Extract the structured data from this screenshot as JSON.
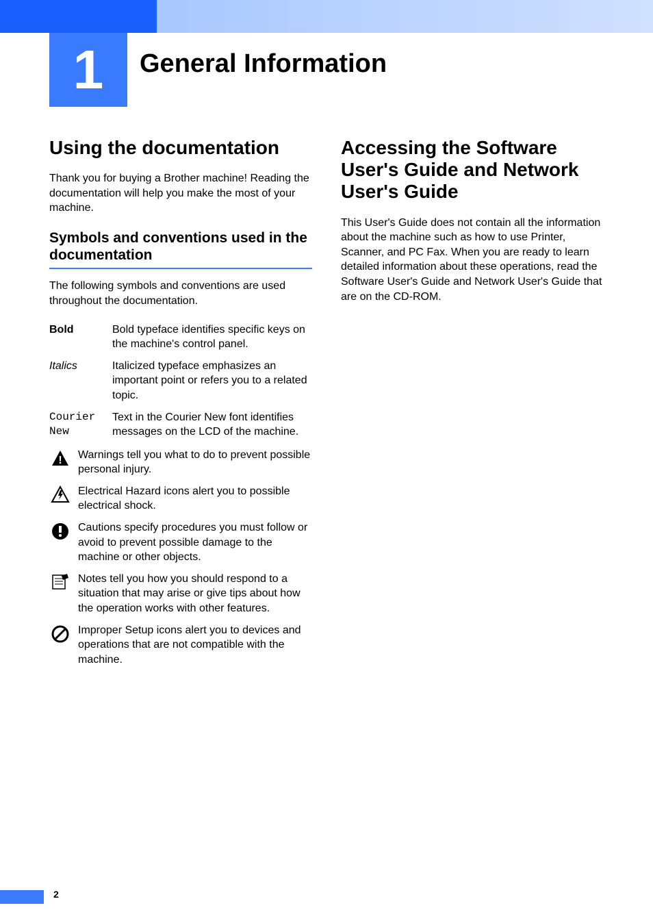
{
  "chapter": {
    "number": "1",
    "title": "General Information"
  },
  "left_column": {
    "section1_title": "Using the documentation",
    "section1_body": "Thank you for buying a Brother machine! Reading the documentation will help you make the most of your machine.",
    "section2_title": "Symbols and conventions used in the documentation",
    "section2_body": "The following symbols and conventions are used throughout the documentation.",
    "conventions": [
      {
        "label": "Bold",
        "style": "bold",
        "desc": "Bold typeface identifies specific keys on the machine's control panel."
      },
      {
        "label": "Italics",
        "style": "italic",
        "desc": "Italicized typeface emphasizes an important point or refers you to a related topic."
      },
      {
        "label": "Courier New",
        "style": "mono",
        "desc": "Text in the Courier New font identifies messages on the LCD of the machine."
      }
    ],
    "icon_descriptions": [
      {
        "icon": "warning",
        "desc": "Warnings tell you what to do to prevent possible personal injury."
      },
      {
        "icon": "electrical",
        "desc": "Electrical Hazard icons alert you to possible electrical shock."
      },
      {
        "icon": "caution",
        "desc": "Cautions specify procedures you must follow or avoid to prevent possible damage to the machine or other objects."
      },
      {
        "icon": "note",
        "desc": "Notes tell you how you should respond to a situation that may arise or give tips about how the operation works with other features."
      },
      {
        "icon": "improper",
        "desc": "Improper Setup icons alert you to devices and operations that are not compatible with the machine."
      }
    ]
  },
  "right_column": {
    "section1_title": "Accessing the Software User's Guide and Network User's Guide",
    "section1_body": "This User's Guide does not contain all the information about the machine such as how to use Printer, Scanner, and PC Fax. When you are ready to learn detailed information about these operations, read the Software User's Guide and Network User's Guide that are on the CD-ROM."
  },
  "page_number": "2"
}
